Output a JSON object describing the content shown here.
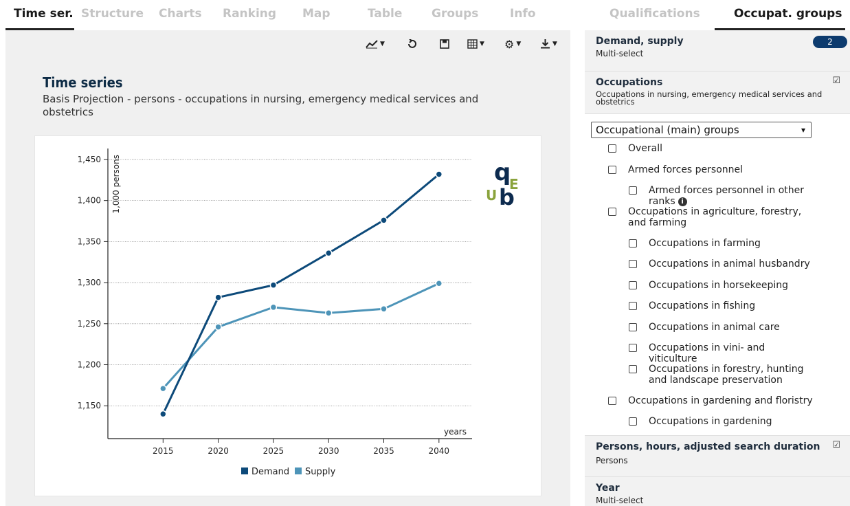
{
  "tabs_left": [
    "Time ser.",
    "Structure",
    "Charts",
    "Ranking",
    "Map",
    "Table",
    "Groups",
    "Info"
  ],
  "tabs_right": [
    "Qualifications",
    "Occupat. groups"
  ],
  "toolbar": {
    "icons": [
      "line-chart-icon",
      "undo-icon",
      "save-icon",
      "table-icon",
      "gear-icon",
      "download-icon"
    ]
  },
  "main": {
    "title": "Time series",
    "subtitle": "Basis Projection - persons - occupations in nursing, emergency medical services and obstetrics"
  },
  "logo": {
    "letters": [
      "q",
      "E",
      "U",
      "b"
    ],
    "colors": {
      "dark": "#0d2b4f",
      "green": "#8aa33c"
    }
  },
  "chart_data": {
    "type": "line",
    "x": [
      2015,
      2020,
      2025,
      2030,
      2035,
      2040
    ],
    "series": [
      {
        "name": "Demand",
        "values": [
          1140,
          1282,
          1297,
          1336,
          1376,
          1432
        ],
        "color": "#0d4a7a"
      },
      {
        "name": "Supply",
        "values": [
          1171,
          1246,
          1270,
          1263,
          1268,
          1299
        ],
        "color": "#4d94b8"
      }
    ],
    "ylabel": "1,000 persons",
    "xlabel": "years",
    "yticks": [
      1150,
      1200,
      1250,
      1300,
      1350,
      1400,
      1450
    ],
    "ytick_labels": [
      "1,150",
      "1,200",
      "1,250",
      "1,300",
      "1,350",
      "1,400",
      "1,450"
    ],
    "ylim": [
      1110,
      1460
    ],
    "xlim": [
      2010,
      2043
    ],
    "grid": "horizontal-dotted",
    "legend_position": "bottom"
  },
  "panel": {
    "demand_supply": {
      "title": "Demand, supply",
      "subtitle": "Multi-select",
      "badge": "2"
    },
    "occupations": {
      "title": "Occupations",
      "subtitle": "Occupations in nursing, emergency medical services and obstetrics"
    },
    "select": {
      "value": "Occupational (main) groups"
    },
    "items": [
      {
        "label": "Overall",
        "level": 0
      },
      {
        "label": "Armed forces personnel",
        "level": 0
      },
      {
        "label": "Armed forces personnel in other ranks",
        "level": 1,
        "info": true
      },
      {
        "label": "Occupations in agriculture, forestry, and farming",
        "level": 0
      },
      {
        "label": "Occupations in farming",
        "level": 1
      },
      {
        "label": "Occupations in animal husbandry",
        "level": 1
      },
      {
        "label": "Occupations in horsekeeping",
        "level": 1
      },
      {
        "label": "Occupations in fishing",
        "level": 1
      },
      {
        "label": "Occupations in animal care",
        "level": 1
      },
      {
        "label": "Occupations in vini- and viticulture",
        "level": 1
      },
      {
        "label": "Occupations in forestry, hunting and landscape preservation",
        "level": 1
      },
      {
        "label": "Occupations in gardening and floristry",
        "level": 0
      },
      {
        "label": "Occupations in gardening",
        "level": 1
      }
    ],
    "persons_hours": {
      "title": "Persons, hours, adjusted search duration",
      "subtitle": "Persons"
    },
    "year": {
      "title": "Year",
      "subtitle": "Multi-select"
    }
  }
}
